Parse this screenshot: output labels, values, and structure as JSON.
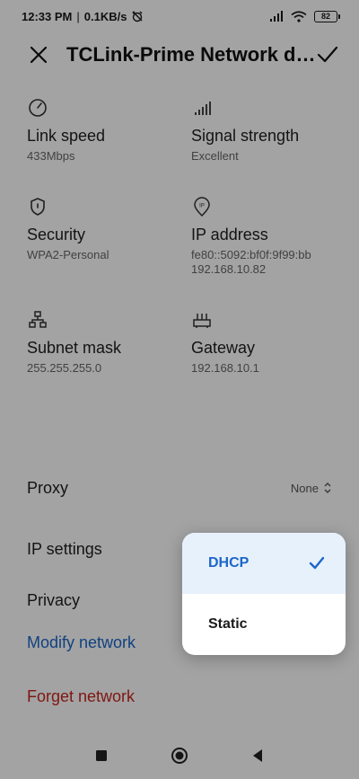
{
  "status_bar": {
    "time": "12:33 PM",
    "separator": "|",
    "speed": "0.1KB/s",
    "battery": "82",
    "icons": [
      "alarm-off-icon",
      "signal-icon",
      "wifi-icon",
      "battery-icon"
    ]
  },
  "header": {
    "title": "TCLink-Prime Network details",
    "close_icon": "close-icon",
    "confirm_icon": "check-icon"
  },
  "info": {
    "link_speed": {
      "label": "Link speed",
      "value": "433Mbps",
      "icon": "speedometer-icon"
    },
    "signal_strength": {
      "label": "Signal strength",
      "value": "Excellent",
      "icon": "signal-bars-icon"
    },
    "security": {
      "label": "Security",
      "value": "WPA2-Personal",
      "icon": "shield-icon"
    },
    "ip_address": {
      "label": "IP address",
      "value_line1": "fe80::5092:bf0f:9f99:bb",
      "value_line2": "192.168.10.82",
      "icon": "location-ip-icon"
    },
    "subnet_mask": {
      "label": "Subnet mask",
      "value": "255.255.255.0",
      "icon": "network-tree-icon"
    },
    "gateway": {
      "label": "Gateway",
      "value": "192.168.10.1",
      "icon": "router-icon"
    }
  },
  "settings": {
    "proxy_label": "Proxy",
    "proxy_value": "None",
    "ip_settings_label": "IP settings",
    "privacy_label": "Privacy",
    "modify_network": "Modify network",
    "forget_network": "Forget network"
  },
  "ip_settings_menu": {
    "options": [
      "DHCP",
      "Static"
    ],
    "selected": "DHCP"
  },
  "colors": {
    "accent_blue": "#1c66c9",
    "danger_red": "#c7261f",
    "selected_bg": "#e7f1fc"
  },
  "nav_bar": {
    "icons": [
      "recents-square-icon",
      "home-circle-icon",
      "back-triangle-icon"
    ]
  }
}
